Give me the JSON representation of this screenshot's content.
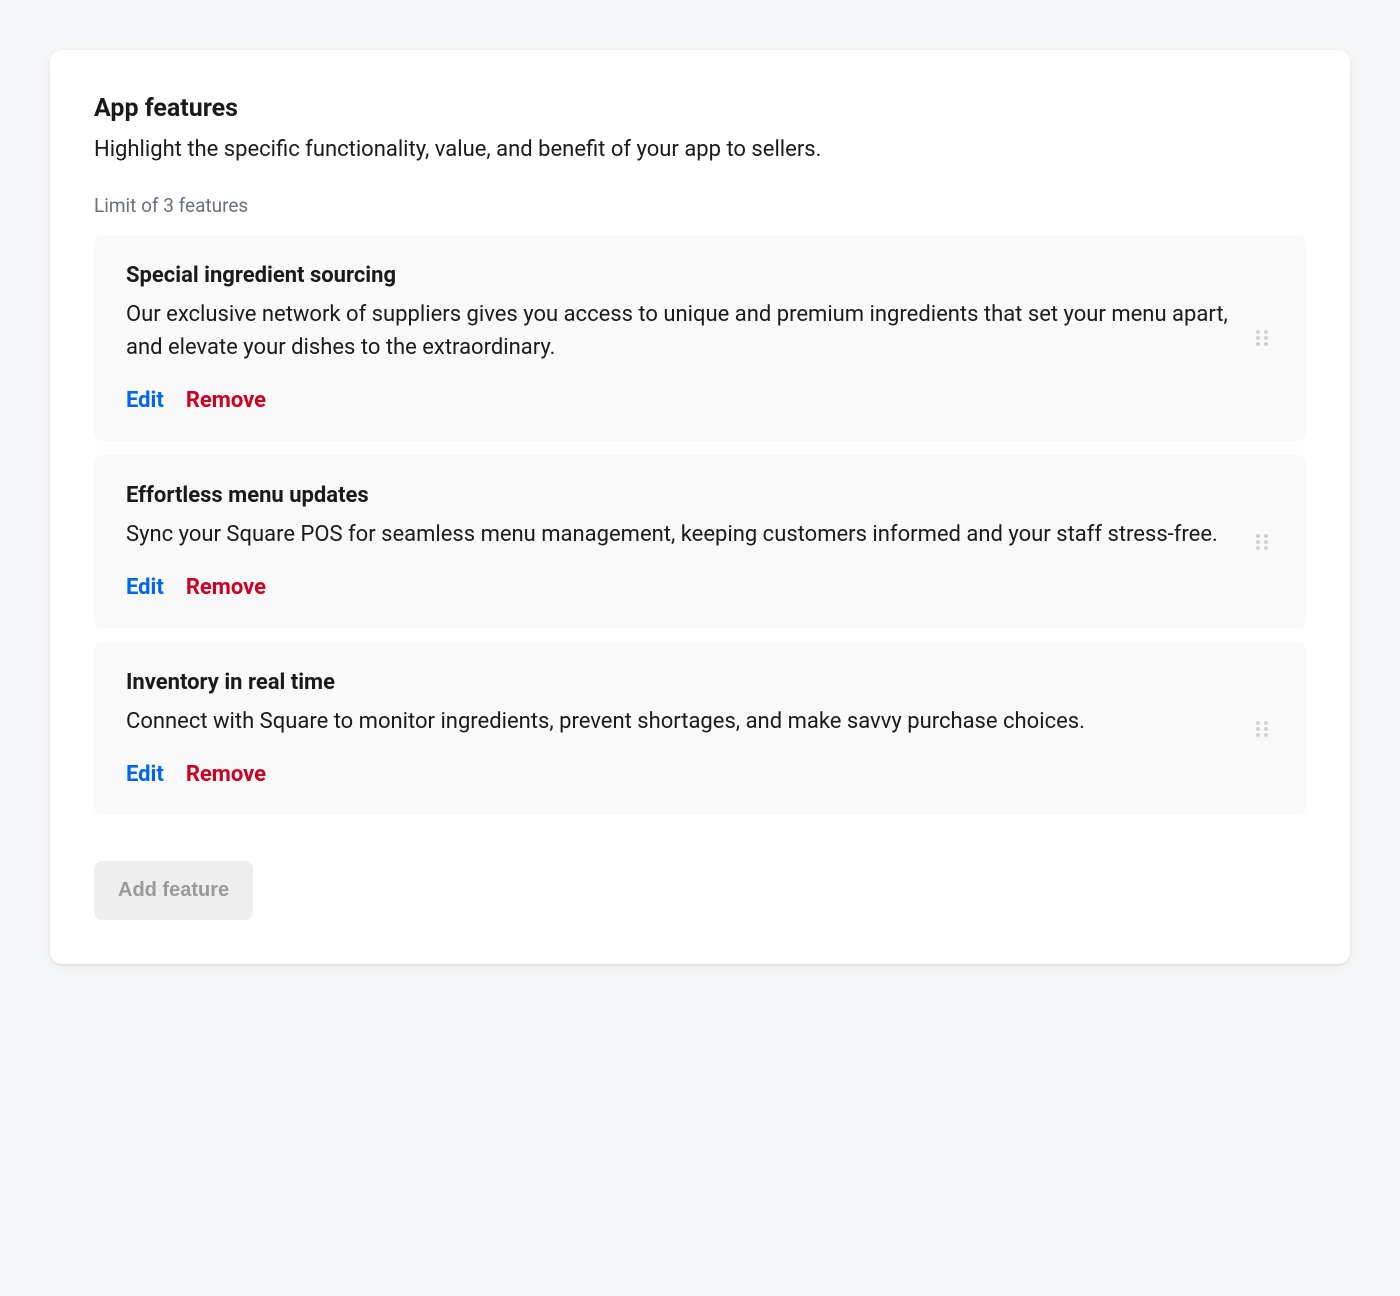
{
  "header": {
    "title": "App features",
    "subtitle": "Highlight the specific functionality, value, and benefit of your app to sellers.",
    "limit": "Limit of 3 features"
  },
  "features": [
    {
      "title": "Special ingredient sourcing",
      "description": "Our exclusive network of suppliers gives you access to unique and premium ingredients that set your menu apart, and elevate your dishes to the extraordinary."
    },
    {
      "title": "Effortless menu updates",
      "description": "Sync your Square POS for seamless menu management, keeping customers informed and your staff stress-free."
    },
    {
      "title": "Inventory in real time",
      "description": "Connect with Square to monitor ingredients, prevent shortages, and make savvy purchase choices."
    }
  ],
  "actions": {
    "edit": "Edit",
    "remove": "Remove",
    "add": "Add feature"
  }
}
